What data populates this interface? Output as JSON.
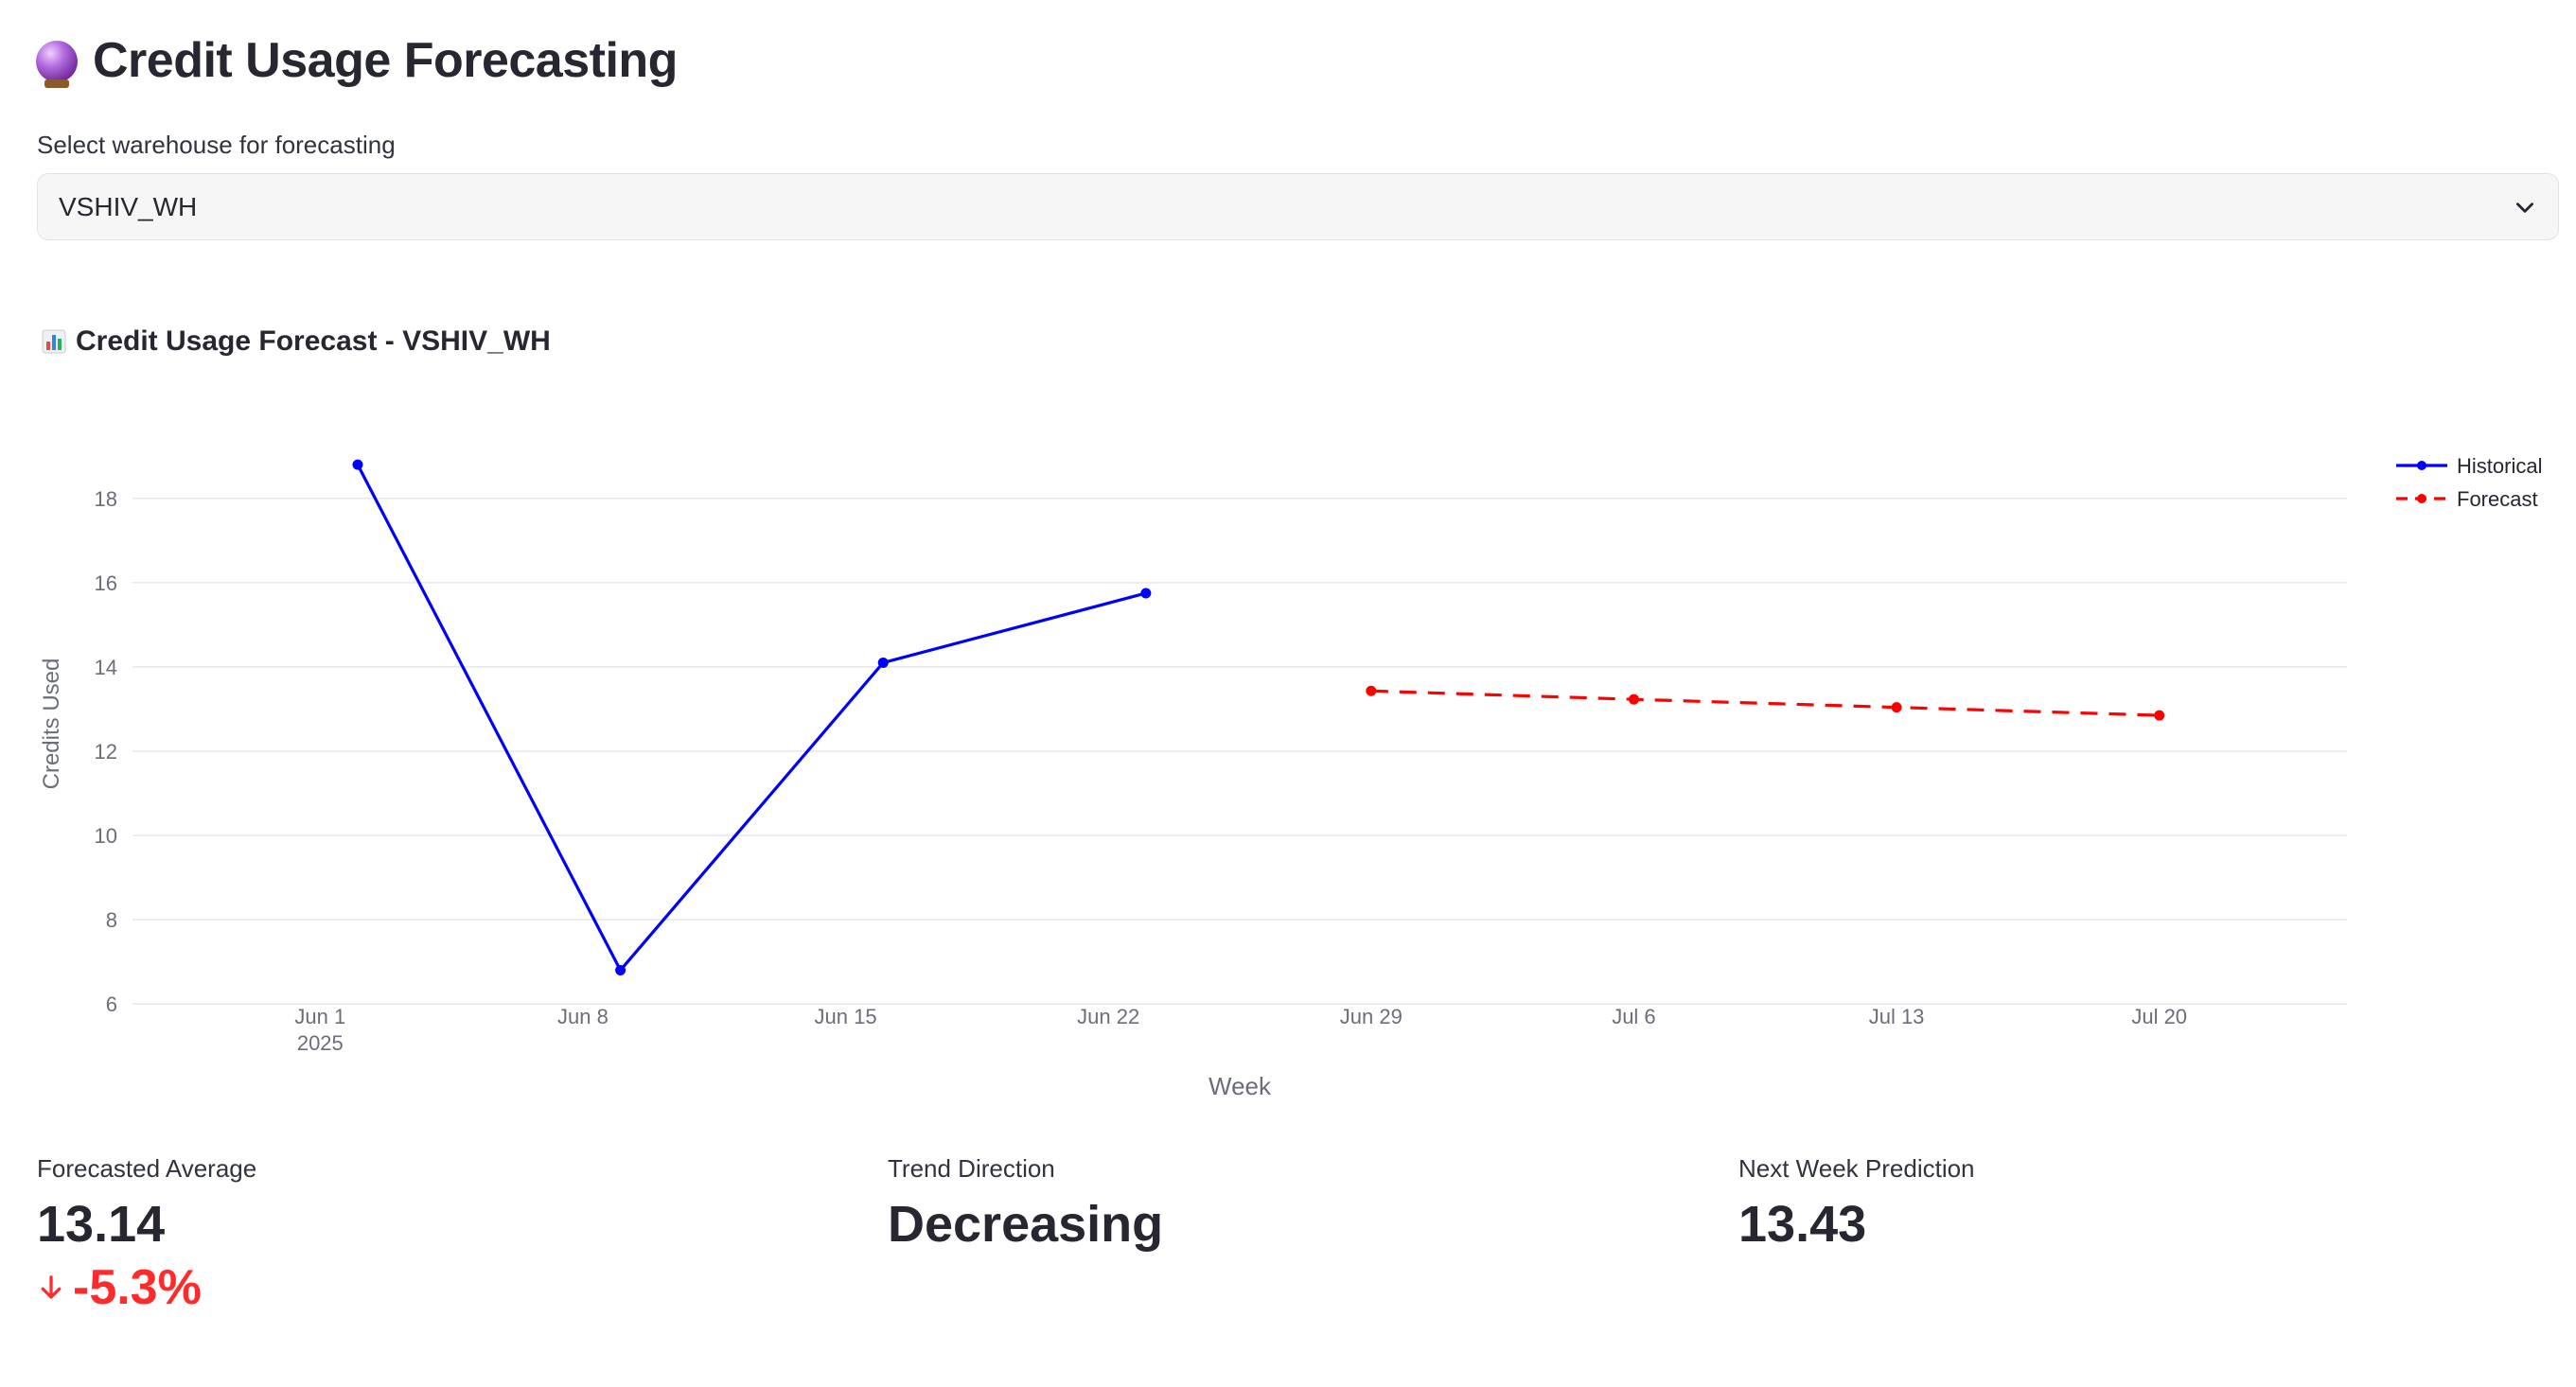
{
  "page": {
    "title": "Credit Usage Forecasting",
    "title_icon": "crystal-ball-icon"
  },
  "warehouse_select": {
    "label": "Select warehouse for forecasting",
    "value": "VSHIV_WH"
  },
  "chart_section": {
    "title": "Credit Usage Forecast - VSHIV_WH",
    "title_icon": "bar-chart-icon"
  },
  "chart_data": {
    "type": "line",
    "title": "",
    "xlabel": "Week",
    "ylabel": "Credits Used",
    "x_ticks": [
      "Jun 1",
      "Jun 8",
      "Jun 15",
      "Jun 22",
      "Jun 29",
      "Jul 6",
      "Jul 13",
      "Jul 20"
    ],
    "x_tick_year": "2025",
    "y_ticks": [
      6,
      8,
      10,
      12,
      14,
      16,
      18
    ],
    "ylim": [
      5.8,
      19.5
    ],
    "grid": true,
    "legend_position": "top-right",
    "series": [
      {
        "name": "Historical",
        "color": "#0000ff",
        "dash": "solid",
        "points": [
          {
            "x": "2025-06-02",
            "y": 18.8
          },
          {
            "x": "2025-06-09",
            "y": 6.8
          },
          {
            "x": "2025-06-16",
            "y": 14.1
          },
          {
            "x": "2025-06-23",
            "y": 15.75
          }
        ]
      },
      {
        "name": "Forecast",
        "color": "#ff0000",
        "dash": "dashed",
        "points": [
          {
            "x": "2025-06-29",
            "y": 13.43
          },
          {
            "x": "2025-07-06",
            "y": 13.23
          },
          {
            "x": "2025-07-13",
            "y": 13.04
          },
          {
            "x": "2025-07-20",
            "y": 12.85
          }
        ]
      }
    ]
  },
  "metrics": [
    {
      "label": "Forecasted Average",
      "value": "13.14",
      "delta": "-5.3%",
      "delta_color": "#ff2b2b",
      "delta_icon": "arrow-down-icon"
    },
    {
      "label": "Trend Direction",
      "value": "Decreasing"
    },
    {
      "label": "Next Week Prediction",
      "value": "13.43"
    }
  ]
}
